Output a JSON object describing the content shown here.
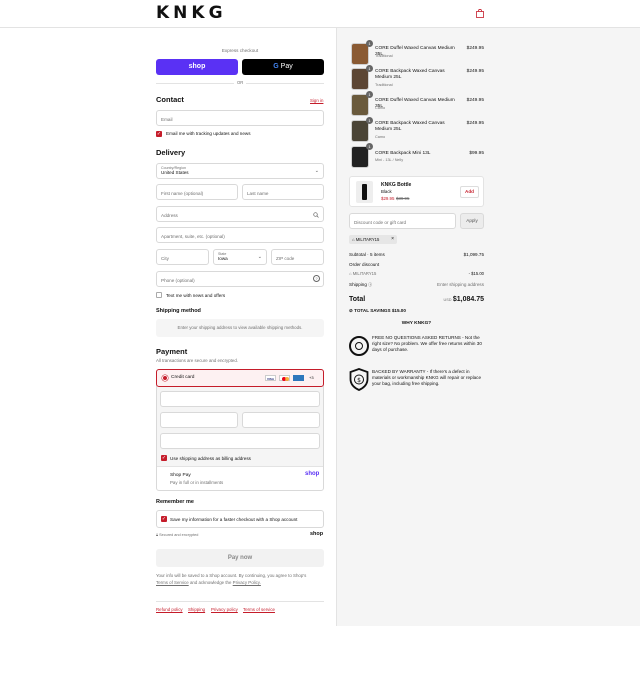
{
  "header": {
    "brand": "KNKG",
    "cart_icon": "shopping-bag-icon"
  },
  "express": {
    "label": "Express checkout",
    "shop_pay": "shop",
    "gpay": "Pay",
    "or": "OR"
  },
  "contact": {
    "title": "Contact",
    "sign_in": "Sign in",
    "email_placeholder": "Email",
    "email_offers": "Email me with tracking updates and news"
  },
  "delivery": {
    "title": "Delivery",
    "country_label": "Country/Region",
    "country_value": "United States",
    "first_name": "First name (optional)",
    "last_name": "Last name",
    "address": "Address",
    "apartment": "Apartment, suite, etc. (optional)",
    "city": "City",
    "state_label": "State",
    "state_value": "Iowa",
    "zip": "ZIP code",
    "phone": "Phone (optional)",
    "text_offers": "Text me with news and offers"
  },
  "shipping": {
    "title": "Shipping method",
    "note": "Enter your shipping address to view available shipping methods."
  },
  "payment": {
    "title": "Payment",
    "subtitle": "All transactions are secure and encrypted.",
    "credit_card": "Credit card",
    "more_cards": "+3",
    "billing_same": "Use shipping address as billing address",
    "shop_pay_title": "Shop Pay",
    "shop_pay_sub": "Pay in full or in installments",
    "shop_pay_logo": "shop"
  },
  "remember": {
    "title": "Remember me",
    "save_info": "Save my information for a faster checkout with a Shop account",
    "secure": "Secured and encrypted",
    "shop_logo": "shop"
  },
  "pay_now": "Pay now",
  "legal": {
    "line1": "Your info will be saved to a Shop account. By continuing, you agree to Shop's",
    "tos": "Terms of Service",
    "and": "and acknowledge the",
    "privacy": "Privacy Policy."
  },
  "footer_links": [
    "Refund policy",
    "Shipping",
    "Privacy policy",
    "Terms of service"
  ],
  "cart": {
    "items": [
      {
        "qty": "1",
        "name": "CORE Duffel Waxed Canvas Medium 35L",
        "variant": "Traditional",
        "price": "$249.95"
      },
      {
        "qty": "1",
        "name": "CORE Backpack Waxed Canvas Medium 25L",
        "variant": "Traditional",
        "price": "$249.95"
      },
      {
        "qty": "1",
        "name": "CORE Duffel Waxed Canvas Medium 35L",
        "variant": "Camo",
        "price": "$249.95"
      },
      {
        "qty": "1",
        "name": "CORE Backpack Waxed Canvas Medium 25L",
        "variant": "Camo",
        "price": "$249.95"
      },
      {
        "qty": "1",
        "name": "CORE Backpack Mini 13L",
        "variant": "Mini - 13L / Nelly",
        "price": "$99.95"
      }
    ],
    "upsell": {
      "name": "KNKG Bottle",
      "variant": "Black",
      "price": "$29.95",
      "compare": "$39.95",
      "add": "Add"
    },
    "discount_placeholder": "Discount code or gift card",
    "apply": "Apply",
    "code": "MILITARY15",
    "subtotal_label": "Subtotal · 5 items",
    "subtotal": "$1,099.75",
    "order_discount": "Order discount",
    "discount_code": "MILITARY15",
    "discount_value": "- $15.00",
    "shipping_label": "Shipping",
    "shipping_value": "Enter shipping address",
    "total_label": "Total",
    "currency": "USD",
    "total": "$1,084.75",
    "savings_label": "TOTAL SAVINGS",
    "savings": "$15.00",
    "why": "WHY KNKG?",
    "promise1": "FREE NO QUESTIONS ASKED RETURNS - Not the right size? No problem. We offer free returns within 30 days of purchase.",
    "promise2": "BACKED BY WARRANTY - If there's a defect in materials or workmanship KNKG will repair or replace your bag, including free shipping."
  },
  "colors": {
    "accent": "#c51c2a",
    "shop_purple": "#5a31f4"
  }
}
